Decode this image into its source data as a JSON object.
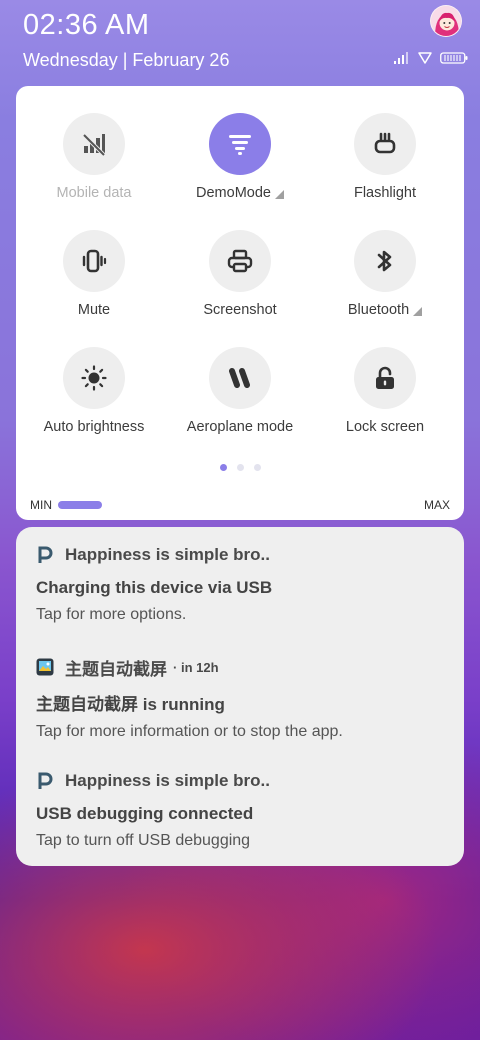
{
  "status_bar": {
    "time": "02:36 AM",
    "date": "Wednesday | February 26",
    "icons": [
      "signal-icon",
      "wifi-icon",
      "battery-icon"
    ]
  },
  "quick_settings": {
    "tiles": [
      {
        "label": "Mobile data",
        "icon": "mobile-data-off-icon",
        "active": false,
        "disabled": true,
        "has_menu": false
      },
      {
        "label": "DemoMode",
        "icon": "demo-mode-icon",
        "active": true,
        "disabled": false,
        "has_menu": true
      },
      {
        "label": "Flashlight",
        "icon": "flashlight-icon",
        "active": false,
        "disabled": false,
        "has_menu": false
      },
      {
        "label": "Mute",
        "icon": "mute-vibrate-icon",
        "active": false,
        "disabled": false,
        "has_menu": false
      },
      {
        "label": "Screenshot",
        "icon": "screenshot-icon",
        "active": false,
        "disabled": false,
        "has_menu": false
      },
      {
        "label": "Bluetooth",
        "icon": "bluetooth-icon",
        "active": false,
        "disabled": false,
        "has_menu": true
      },
      {
        "label": "Auto brightness",
        "icon": "brightness-icon",
        "active": false,
        "disabled": false,
        "has_menu": false
      },
      {
        "label": "Aeroplane mode",
        "icon": "aeroplane-icon",
        "active": false,
        "disabled": false,
        "has_menu": false
      },
      {
        "label": "Lock screen",
        "icon": "lock-icon",
        "active": false,
        "disabled": false,
        "has_menu": false
      }
    ],
    "page_index": 1,
    "page_count": 3,
    "brightness": {
      "min_label": "MIN",
      "max_label": "MAX",
      "level": 0.12
    },
    "accent_color": "#8b7ee8"
  },
  "notifications": [
    {
      "app": "Happiness is simple bro..",
      "time": "",
      "title": "Charging this device via USB",
      "text": "Tap for more options.",
      "icon": "p-app-icon"
    },
    {
      "app": "主题自动截屏",
      "time": "in 12h",
      "title": "主题自动截屏 is running",
      "text": "Tap for more information or to stop the app.",
      "icon": "gallery-app-icon"
    },
    {
      "app": "Happiness is simple bro..",
      "time": "",
      "title": "USB debugging connected",
      "text": "Tap to turn off USB debugging",
      "icon": "p-app-icon"
    }
  ]
}
